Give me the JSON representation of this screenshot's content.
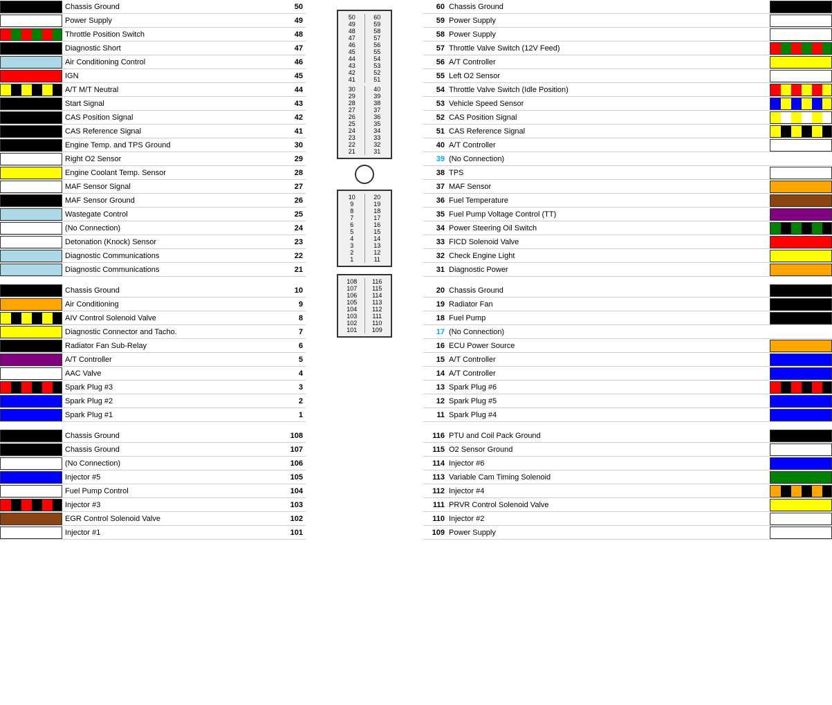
{
  "left": {
    "rows_top": [
      {
        "label": "Chassis Ground",
        "num": "50",
        "color": "black",
        "type": "solid"
      },
      {
        "label": "Power Supply",
        "num": "49",
        "color": "",
        "type": "none"
      },
      {
        "label": "Throttle Position Switch",
        "num": "48",
        "color": "",
        "type": "stripe-ro"
      },
      {
        "label": "Diagnostic Short",
        "num": "47",
        "color": "black",
        "type": "solid"
      },
      {
        "label": "Air Conditioning Control",
        "num": "46",
        "color": "#add8e6",
        "type": "solid"
      },
      {
        "label": "IGN",
        "num": "45",
        "color": "red",
        "type": "solid"
      },
      {
        "label": "A/T M/T Neutral",
        "num": "44",
        "color": "",
        "type": "stripe-yb"
      },
      {
        "label": "Start Signal",
        "num": "43",
        "color": "black",
        "type": "solid"
      },
      {
        "label": "CAS Position Signal",
        "num": "42",
        "color": "black",
        "type": "solid"
      },
      {
        "label": "CAS Reference Signal",
        "num": "41",
        "color": "black",
        "type": "solid"
      },
      {
        "label": "Engine Temp. and TPS Ground",
        "num": "30",
        "color": "black",
        "type": "solid"
      },
      {
        "label": "Right O2 Sensor",
        "num": "29",
        "color": "",
        "type": "none"
      },
      {
        "label": "Engine Coolant Temp. Sensor",
        "num": "28",
        "color": "yellow",
        "type": "solid"
      },
      {
        "label": "MAF Sensor Signal",
        "num": "27",
        "color": "",
        "type": "none"
      },
      {
        "label": "MAF Sensor Ground",
        "num": "26",
        "color": "black",
        "type": "solid"
      },
      {
        "label": "Wastegate Control",
        "num": "25",
        "color": "#add8e6",
        "type": "solid"
      },
      {
        "label": "(No Connection)",
        "num": "24",
        "color": "",
        "type": "none"
      },
      {
        "label": "Detonation (Knock) Sensor",
        "num": "23",
        "color": "",
        "type": "none"
      },
      {
        "label": "Diagnostic Communications",
        "num": "22",
        "color": "#add8e6",
        "type": "solid"
      },
      {
        "label": "Diagnostic Communications",
        "num": "21",
        "color": "#add8e6",
        "type": "solid"
      }
    ],
    "rows_mid": [
      {
        "label": "Chassis Ground",
        "num": "10",
        "color": "black",
        "type": "solid"
      },
      {
        "label": "Air Conditioning",
        "num": "9",
        "color": "orange",
        "type": "solid"
      },
      {
        "label": "AIV Control Solenoid Valve",
        "num": "8",
        "color": "",
        "type": "stripe-yg"
      },
      {
        "label": "Diagnostic Connector and Tacho.",
        "num": "7",
        "color": "yellow",
        "type": "solid"
      },
      {
        "label": "Radiator Fan Sub-Relay",
        "num": "6",
        "color": "black",
        "type": "solid"
      },
      {
        "label": "A/T Controller",
        "num": "5",
        "color": "purple",
        "type": "solid"
      },
      {
        "label": "AAC Valve",
        "num": "4",
        "color": "",
        "type": "none"
      },
      {
        "label": "Spark Plug #3",
        "num": "3",
        "color": "",
        "type": "stripe-rb"
      },
      {
        "label": "Spark Plug #2",
        "num": "2",
        "color": "blue",
        "type": "solid"
      },
      {
        "label": "Spark Plug #1",
        "num": "1",
        "color": "blue",
        "type": "solid"
      }
    ],
    "rows_bot": [
      {
        "label": "Chassis Ground",
        "num": "108",
        "color": "black",
        "type": "solid"
      },
      {
        "label": "Chassis Ground",
        "num": "107",
        "color": "black",
        "type": "solid"
      },
      {
        "label": "(No Connection)",
        "num": "106",
        "color": "",
        "type": "none"
      },
      {
        "label": "Injector #5",
        "num": "105",
        "color": "blue",
        "type": "solid"
      },
      {
        "label": "Fuel Pump Control",
        "num": "104",
        "color": "",
        "type": "none"
      },
      {
        "label": "Injector #3",
        "num": "103",
        "color": "",
        "type": "stripe-rb2"
      },
      {
        "label": "EGR Control Solenoid Valve",
        "num": "102",
        "color": "#8B4513",
        "type": "solid"
      },
      {
        "label": "Injector #1",
        "num": "101",
        "color": "",
        "type": "none"
      }
    ]
  },
  "right": {
    "rows_top": [
      {
        "label": "Chassis Ground",
        "num": "60",
        "color": "black",
        "type": "solid"
      },
      {
        "label": "Power Supply",
        "num": "59",
        "color": "",
        "type": "none"
      },
      {
        "label": "Power Supply",
        "num": "58",
        "color": "",
        "type": "none"
      },
      {
        "label": "Throttle Valve Switch (12V Feed)",
        "num": "57",
        "color": "",
        "type": "stripe-rg"
      },
      {
        "label": "A/T Controller",
        "num": "56",
        "color": "yellow",
        "type": "solid"
      },
      {
        "label": "Left O2 Sensor",
        "num": "55",
        "color": "",
        "type": "none"
      },
      {
        "label": "Throttle Valve Switch (Idle Position)",
        "num": "54",
        "color": "",
        "type": "stripe-ry"
      },
      {
        "label": "Vehicle Speed Sensor",
        "num": "53",
        "color": "",
        "type": "stripe-yg"
      },
      {
        "label": "CAS Position Signal",
        "num": "52",
        "color": "",
        "type": "stripe-yw"
      },
      {
        "label": "CAS Reference Signal",
        "num": "51",
        "color": "",
        "type": "stripe-yb"
      },
      {
        "label": "A/T Controller",
        "num": "40",
        "color": "",
        "type": "none"
      },
      {
        "label": "(No Connection)",
        "num": "39",
        "color": "",
        "type": "none",
        "no_conn": true
      },
      {
        "label": "TPS",
        "num": "38",
        "color": "",
        "type": "none"
      },
      {
        "label": "MAF Sensor",
        "num": "37",
        "color": "orange",
        "type": "solid"
      },
      {
        "label": "Fuel Temperature",
        "num": "36",
        "color": "#8B4513",
        "type": "solid"
      },
      {
        "label": "Fuel Pump Voltage Control (TT)",
        "num": "35",
        "color": "purple",
        "type": "solid"
      },
      {
        "label": "Power Steering Oil Switch",
        "num": "34",
        "color": "",
        "type": "stripe-yg2"
      },
      {
        "label": "FICD Solenoid Valve",
        "num": "33",
        "color": "red",
        "type": "solid"
      },
      {
        "label": "Check Engine Light",
        "num": "32",
        "color": "yellow",
        "type": "solid"
      },
      {
        "label": "Diagnostic Power",
        "num": "31",
        "color": "orange",
        "type": "solid"
      }
    ],
    "rows_mid": [
      {
        "label": "Chassis Ground",
        "num": "20",
        "color": "black",
        "type": "solid"
      },
      {
        "label": "Radiator Fan",
        "num": "19",
        "color": "black",
        "type": "solid"
      },
      {
        "label": "Fuel Pump",
        "num": "18",
        "color": "black",
        "type": "solid"
      },
      {
        "label": "(No Connection)",
        "num": "17",
        "color": "",
        "type": "none",
        "no_conn": true
      },
      {
        "label": "ECU Power Source",
        "num": "16",
        "color": "orange",
        "type": "solid"
      },
      {
        "label": "A/T Controller",
        "num": "15",
        "color": "blue",
        "type": "solid"
      },
      {
        "label": "A/T Controller",
        "num": "14",
        "color": "blue",
        "type": "solid"
      },
      {
        "label": "Spark Plug #6",
        "num": "13",
        "color": "",
        "type": "stripe-rb3"
      },
      {
        "label": "Spark Plug #5",
        "num": "12",
        "color": "blue",
        "type": "solid"
      },
      {
        "label": "Spark Plug #4",
        "num": "11",
        "color": "blue",
        "type": "solid"
      }
    ],
    "rows_bot": [
      {
        "label": "PTU and Coil Pack Ground",
        "num": "116",
        "color": "black",
        "type": "solid"
      },
      {
        "label": "O2 Sensor Ground",
        "num": "115",
        "color": "",
        "type": "none"
      },
      {
        "label": "Injector #6",
        "num": "114",
        "color": "blue",
        "type": "solid"
      },
      {
        "label": "Variable Cam Timing Solenoid",
        "num": "113",
        "color": "green",
        "type": "solid"
      },
      {
        "label": "Injector #4",
        "num": "112",
        "color": "",
        "type": "stripe-ob"
      },
      {
        "label": "PRVR Control Solenoid Valve",
        "num": "111",
        "color": "yellow",
        "type": "solid"
      },
      {
        "label": "Injector #2",
        "num": "110",
        "color": "",
        "type": "none"
      },
      {
        "label": "Power Supply",
        "num": "109",
        "color": "",
        "type": "none"
      }
    ]
  }
}
